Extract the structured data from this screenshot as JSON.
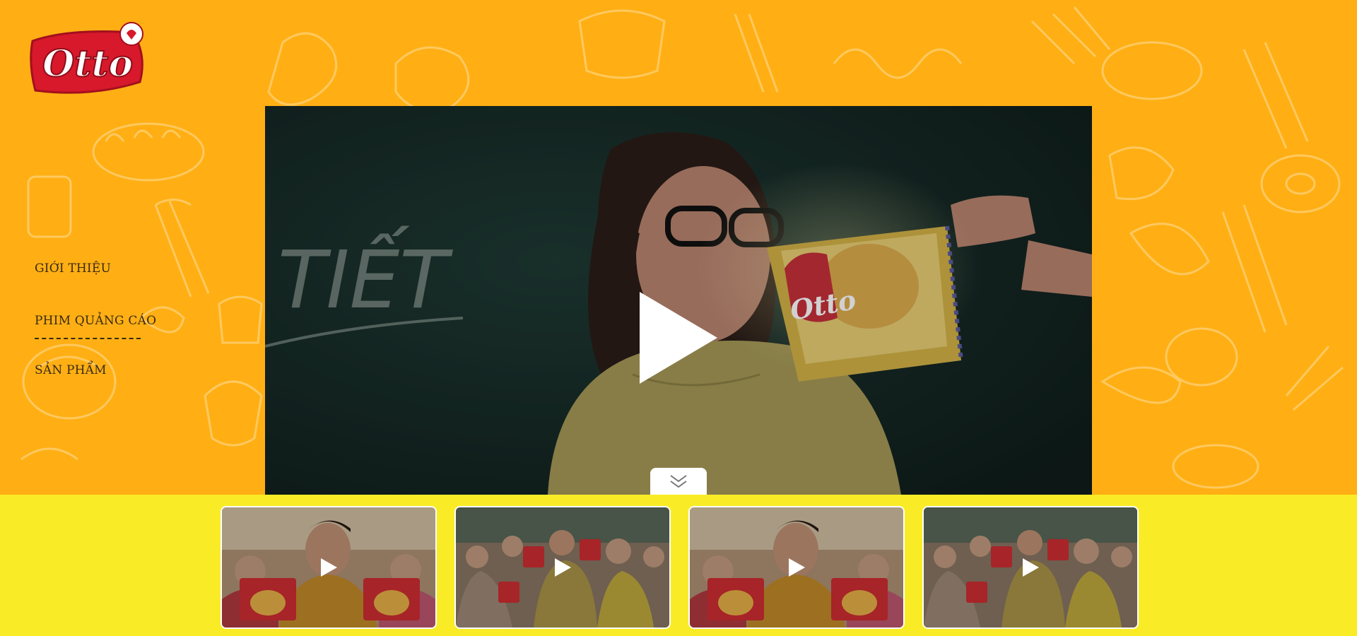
{
  "brand": {
    "logo_text": "Otto",
    "colors": {
      "background": "#FFAF14",
      "strip": "#F9EC26",
      "logo_red": "#D7192B",
      "nav_text": "#3a2a12"
    }
  },
  "nav": {
    "items": [
      {
        "label": "GIỚI THIỆU",
        "active": false
      },
      {
        "label": "PHIM QUẢNG CÁO",
        "active": true
      },
      {
        "label": "SẢN PHẨM",
        "active": false
      }
    ]
  },
  "main_video": {
    "chalkboard_text": "TIẾT",
    "product_logo_text": "Otto",
    "play_icon": "play-icon",
    "collapse_icon": "chevron-down-double-icon"
  },
  "thumbnails": [
    {
      "scene": "man-yellow-jacket",
      "icon": "play-icon"
    },
    {
      "scene": "group-classroom",
      "icon": "play-icon"
    },
    {
      "scene": "man-yellow-jacket",
      "icon": "play-icon"
    },
    {
      "scene": "group-classroom",
      "icon": "play-icon"
    }
  ]
}
